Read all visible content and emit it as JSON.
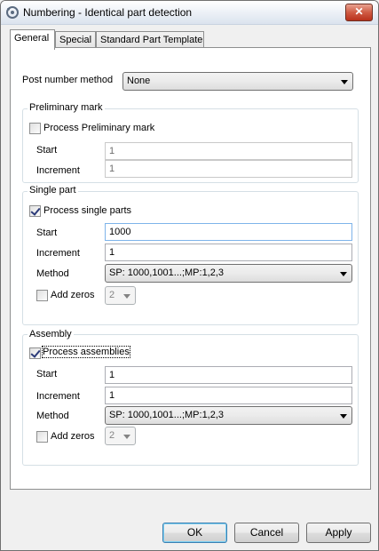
{
  "window": {
    "title": "Numbering - Identical part detection",
    "close_glyph": "✕"
  },
  "tabs": [
    {
      "label": "General"
    },
    {
      "label": "Special"
    },
    {
      "label": "Standard Part Template"
    }
  ],
  "post_number": {
    "label": "Post number method",
    "value": "None"
  },
  "preliminary": {
    "title": "Preliminary mark",
    "process_label": "Process Preliminary mark",
    "process_checked": false,
    "start_label": "Start",
    "start_value": "1",
    "increment_label": "Increment",
    "increment_value": "1"
  },
  "single_part": {
    "title": "Single part",
    "process_label": "Process single parts",
    "process_checked": true,
    "start_label": "Start",
    "start_value": "1000",
    "increment_label": "Increment",
    "increment_value": "1",
    "method_label": "Method",
    "method_value": "SP: 1000,1001...;MP:1,2,3",
    "add_zeros_label": "Add zeros",
    "add_zeros_checked": false,
    "add_zeros_value": "2"
  },
  "assembly": {
    "title": "Assembly",
    "process_label": "Process assemblies",
    "process_checked": true,
    "start_label": "Start",
    "start_value": "1",
    "increment_label": "Increment",
    "increment_value": "1",
    "method_label": "Method",
    "method_value": "SP: 1000,1001...;MP:1,2,3",
    "add_zeros_label": "Add zeros",
    "add_zeros_checked": false,
    "add_zeros_value": "2"
  },
  "buttons": {
    "ok": "OK",
    "cancel": "Cancel",
    "apply": "Apply"
  },
  "icons": {
    "app": "gear-arrow-icon",
    "dropdown": "chevron-down-icon"
  }
}
